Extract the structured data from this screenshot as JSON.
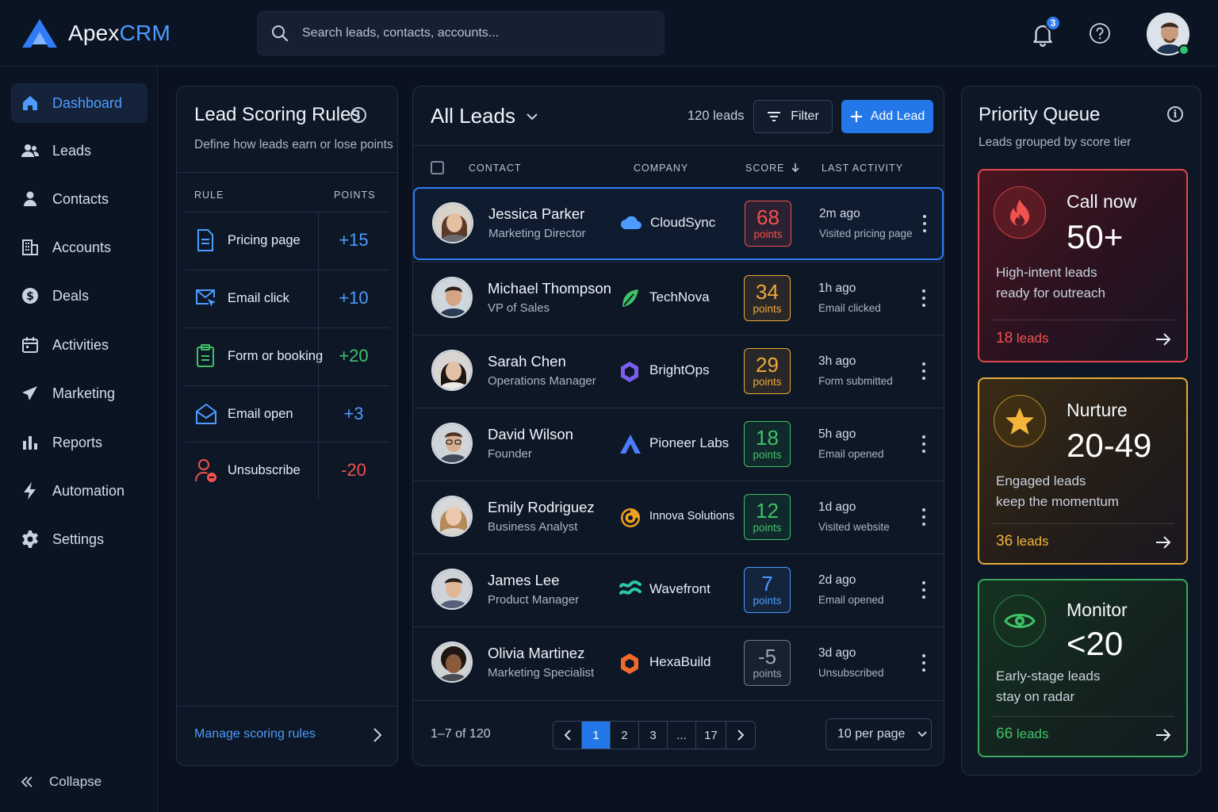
{
  "app": {
    "name_main": "Apex",
    "name_accent": "CRM"
  },
  "search": {
    "placeholder": "Search leads, contacts, accounts..."
  },
  "notifications": {
    "count": "3"
  },
  "sidebar": {
    "items": [
      {
        "label": "Dashboard",
        "icon": "home-icon",
        "active": true
      },
      {
        "label": "Leads",
        "icon": "users-icon"
      },
      {
        "label": "Contacts",
        "icon": "user-icon"
      },
      {
        "label": "Accounts",
        "icon": "building-icon"
      },
      {
        "label": "Deals",
        "icon": "dollar-icon"
      },
      {
        "label": "Activities",
        "icon": "calendar-icon"
      },
      {
        "label": "Marketing",
        "icon": "send-icon"
      },
      {
        "label": "Reports",
        "icon": "bar-chart-icon"
      },
      {
        "label": "Automation",
        "icon": "bolt-icon"
      },
      {
        "label": "Settings",
        "icon": "gear-icon"
      }
    ],
    "collapse_label": "Collapse"
  },
  "rules_panel": {
    "title": "Lead Scoring Rules",
    "subtitle": "Define how leads earn or lose points",
    "col_rule": "RULE",
    "col_points": "POINTS",
    "rules": [
      {
        "label": "Pricing page",
        "points": "+15",
        "icon": "document-icon",
        "color": "#4d9bff"
      },
      {
        "label": "Email click",
        "points": "+10",
        "icon": "email-click-icon",
        "color": "#4d9bff"
      },
      {
        "label": "Form or booking",
        "points": "+20",
        "icon": "clipboard-icon",
        "color": "#3fc267"
      },
      {
        "label": "Email open",
        "points": "+3",
        "icon": "email-open-icon",
        "color": "#4d9bff"
      },
      {
        "label": "Unsubscribe",
        "points": "-20",
        "icon": "user-remove-icon",
        "color": "#f0524f"
      }
    ],
    "manage_label": "Manage scoring rules"
  },
  "leads_panel": {
    "title": "All Leads",
    "count": "120 leads",
    "filter_label": "Filter",
    "add_label": "Add Lead",
    "columns": {
      "contact": "CONTACT",
      "company": "COMPANY",
      "score": "SCORE",
      "activity": "LAST ACTIVITY"
    },
    "rows": [
      {
        "name": "Jessica Parker",
        "role": "Marketing Director",
        "company": "CloudSync",
        "score": "68",
        "points_label": "points",
        "score_color": "#f0524f",
        "when": "2m ago",
        "activity": "Visited pricing page"
      },
      {
        "name": "Michael Thompson",
        "role": "VP of Sales",
        "company": "TechNova",
        "score": "34",
        "points_label": "points",
        "score_color": "#f0a83a",
        "when": "1h ago",
        "activity": "Email clicked"
      },
      {
        "name": "Sarah Chen",
        "role": "Operations Manager",
        "company": "BrightOps",
        "score": "29",
        "points_label": "points",
        "score_color": "#f0a83a",
        "when": "3h ago",
        "activity": "Form submitted"
      },
      {
        "name": "David Wilson",
        "role": "Founder",
        "company": "Pioneer Labs",
        "score": "18",
        "points_label": "points",
        "score_color": "#3fc267",
        "when": "5h ago",
        "activity": "Email opened"
      },
      {
        "name": "Emily Rodriguez",
        "role": "Business Analyst",
        "company": "Innova Solutions",
        "score": "12",
        "points_label": "points",
        "score_color": "#3fc267",
        "when": "1d ago",
        "activity": "Visited website"
      },
      {
        "name": "James Lee",
        "role": "Product Manager",
        "company": "Wavefront",
        "score": "7",
        "points_label": "points",
        "score_color": "#4d9bff",
        "when": "2d ago",
        "activity": "Email opened"
      },
      {
        "name": "Olivia Martinez",
        "role": "Marketing Specialist",
        "company": "HexaBuild",
        "score": "-5",
        "points_label": "points",
        "score_color": "#9aa6b6",
        "when": "3d ago",
        "activity": "Unsubscribed"
      }
    ],
    "range": "1–7 of 120",
    "pages": [
      "1",
      "2",
      "3",
      "...",
      "17"
    ],
    "per_page": "10 per page"
  },
  "queue_panel": {
    "title": "Priority Queue",
    "subtitle": "Leads grouped by score tier",
    "cards": [
      {
        "title": "Call now",
        "range": "50+",
        "desc_line1": "High-intent leads",
        "desc_line2": "ready for outreach",
        "count_num": "18",
        "count_word": "leads",
        "icon": "fire-icon",
        "accent": "#f0524f"
      },
      {
        "title": "Nurture",
        "range": "20-49",
        "desc_line1": "Engaged leads",
        "desc_line2": "keep the momentum",
        "count_num": "36",
        "count_word": "leads",
        "icon": "star-icon",
        "accent": "#f3b43a"
      },
      {
        "title": "Monitor",
        "range": "<20",
        "desc_line1": "Early-stage leads",
        "desc_line2": "stay on radar",
        "count_num": "66",
        "count_word": "leads",
        "icon": "eye-icon",
        "accent": "#3fc267"
      }
    ]
  }
}
